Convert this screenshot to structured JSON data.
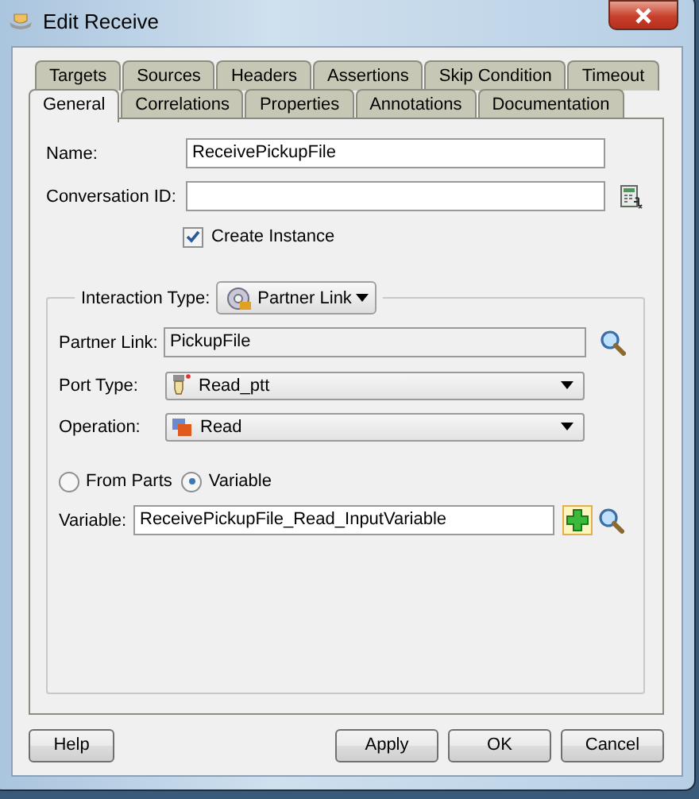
{
  "window": {
    "title": "Edit Receive"
  },
  "tab_rows": [
    [
      {
        "label": "Targets",
        "selected": false
      },
      {
        "label": "Sources",
        "selected": false
      },
      {
        "label": "Headers",
        "selected": false
      },
      {
        "label": "Assertions",
        "selected": false
      },
      {
        "label": "Skip Condition",
        "selected": false
      },
      {
        "label": "Timeout",
        "selected": false
      }
    ],
    [
      {
        "label": "General",
        "selected": true
      },
      {
        "label": "Correlations",
        "selected": false
      },
      {
        "label": "Properties",
        "selected": false
      },
      {
        "label": "Annotations",
        "selected": false
      },
      {
        "label": "Documentation",
        "selected": false
      }
    ]
  ],
  "name": {
    "label": "Name:",
    "value": "ReceivePickupFile"
  },
  "conversation_id": {
    "label": "Conversation ID:"
  },
  "create_instance": {
    "label": "Create Instance",
    "checked": true
  },
  "interaction_type": {
    "label": "Interaction Type:",
    "value": "Partner Link"
  },
  "partner_link": {
    "label": "Partner Link:",
    "value": "PickupFile"
  },
  "port_type": {
    "label": "Port Type:",
    "value": "Read_ptt"
  },
  "operation": {
    "label": "Operation:",
    "value": "Read"
  },
  "radios": [
    {
      "label": "From Parts",
      "selected": false
    },
    {
      "label": "Variable",
      "selected": true
    }
  ],
  "variable": {
    "label": "Variable:",
    "value": "ReceivePickupFile_Read_InputVariable"
  },
  "buttons": [
    {
      "label": "Help",
      "kind": "left"
    },
    {
      "label": "Apply",
      "kind": "right"
    },
    {
      "label": "OK",
      "kind": "right"
    },
    {
      "label": "Cancel",
      "kind": "right"
    }
  ]
}
